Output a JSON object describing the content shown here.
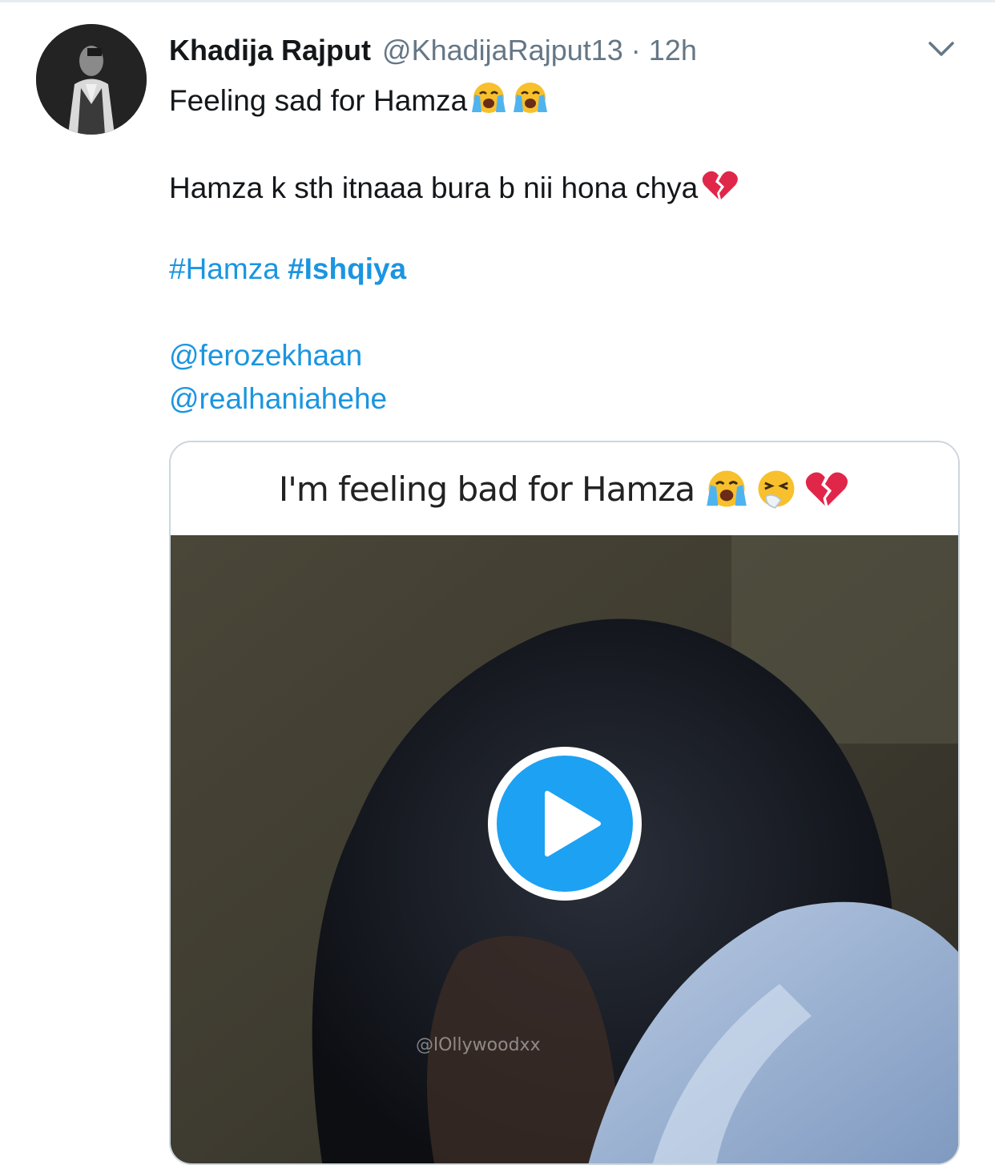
{
  "tweet": {
    "author_name": "Khadija Rajput",
    "author_handle": "@KhadijaRajput13",
    "separator": "·",
    "timestamp": "12h",
    "line1": "Feeling sad for Hamza",
    "line2": "Hamza k sth itnaaa bura b nii hona chya",
    "hashtag1": "#Hamza",
    "hashtag2": "#Ishqiya",
    "mention1": "@ferozekhaan",
    "mention2": "@realhaniahehe",
    "icons": [
      "avatar",
      "chevron-down-icon",
      "loudly-crying-face-emoji",
      "broken-heart-emoji",
      "sneezing-face-emoji",
      "play-icon"
    ]
  },
  "media": {
    "caption": "I'm feeling bad for Hamza",
    "watermark": "@lOllywoodxx",
    "play_color": "#1da1f2"
  }
}
